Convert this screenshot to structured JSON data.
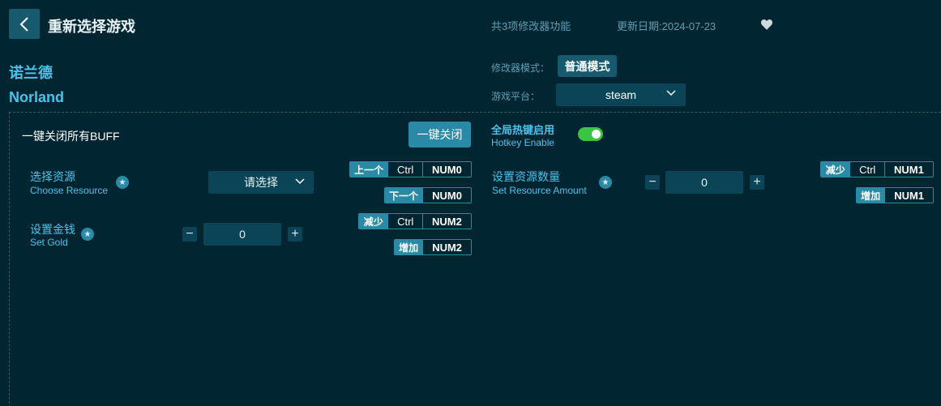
{
  "header": {
    "title": "重新选择游戏",
    "feature_count": "共3项修改器功能",
    "update_date": "更新日期:2024-07-23"
  },
  "game": {
    "name_cn": "诺兰德",
    "name_en": "Norland"
  },
  "settings": {
    "mode_label": "修改器模式：",
    "mode_value": "普通模式",
    "platform_label": "游戏平台：",
    "platform_value": "steam"
  },
  "buff": {
    "label": "一键关闭所有BUFF",
    "button": "一键关闭"
  },
  "hotkey": {
    "cn": "全局热键启用",
    "en": "Hotkey Enable",
    "enabled": true
  },
  "options": {
    "choose_resource": {
      "cn": "选择资源",
      "en": "Choose Resource",
      "select_placeholder": "请选择",
      "hotkeys": [
        {
          "action": "上一个",
          "keys": [
            "Ctrl",
            "NUM0"
          ]
        },
        {
          "action": "下一个",
          "keys": [
            "NUM0"
          ]
        }
      ]
    },
    "set_gold": {
      "cn": "设置金钱",
      "en": "Set Gold",
      "value": "0",
      "minus": "−",
      "plus": "+",
      "hotkeys": [
        {
          "action": "减少",
          "keys": [
            "Ctrl",
            "NUM2"
          ]
        },
        {
          "action": "增加",
          "keys": [
            "NUM2"
          ]
        }
      ]
    },
    "set_resource_amount": {
      "cn": "设置资源数量",
      "en": "Set Resource Amount",
      "value": "0",
      "minus": "−",
      "plus": "+",
      "hotkeys": [
        {
          "action": "减少",
          "keys": [
            "Ctrl",
            "NUM1"
          ]
        },
        {
          "action": "增加",
          "keys": [
            "NUM1"
          ]
        }
      ]
    }
  },
  "colors": {
    "background": "#022532",
    "accent": "#49c3ea",
    "button": "#2a8aa6",
    "toggle_on": "#3cc341"
  },
  "icons": [
    "chevron-left-icon",
    "heart-icon",
    "chevron-down-icon",
    "star-icon"
  ]
}
